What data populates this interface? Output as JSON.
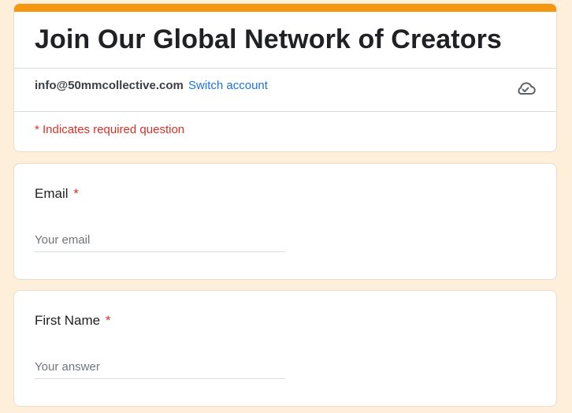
{
  "form": {
    "title": "Join Our Global Network of Creators",
    "account_email": "info@50mmcollective.com",
    "switch_account_label": "Switch account",
    "required_note": "* Indicates required question",
    "accent_color": "#f4960e",
    "background_color": "#fdefd9",
    "saved_status_icon": "cloud-check-icon"
  },
  "questions": [
    {
      "label": "Email",
      "required_marker": "*",
      "placeholder": "Your email",
      "value": ""
    },
    {
      "label": "First Name",
      "required_marker": "*",
      "placeholder": "Your answer",
      "value": ""
    }
  ]
}
